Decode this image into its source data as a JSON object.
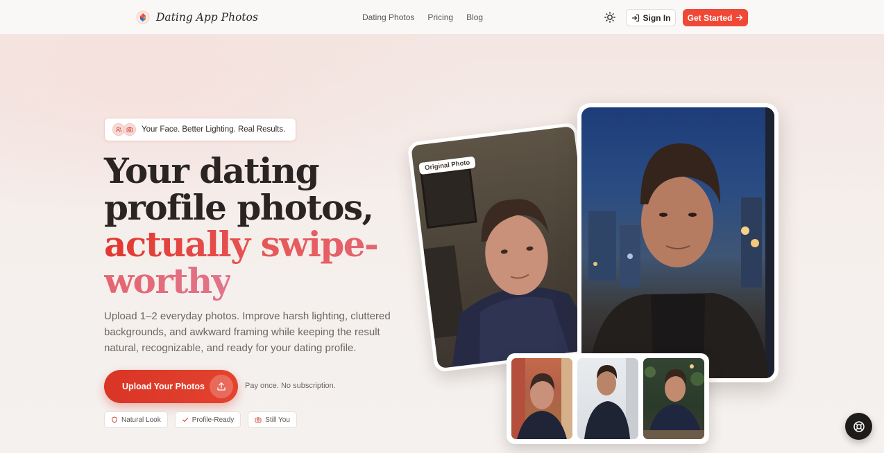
{
  "nav": {
    "brand": "Dating App Photos",
    "links": [
      "Dating Photos",
      "Pricing",
      "Blog"
    ],
    "sign_in": "Sign In",
    "get_started": "Get Started"
  },
  "hero": {
    "badge": "Your Face. Better Lighting. Real Results.",
    "headline_line1": "Your dating",
    "headline_line2": "profile photos,",
    "headline_accent": "actually swipe-worthy",
    "subtext": "Upload 1–2 everyday photos. Improve harsh lighting, cluttered backgrounds, and awkward framing while keeping the result natural, recognizable, and ready for your dating profile.",
    "upload_button": "Upload Your Photos",
    "pricing_note": "Pay once. No subscription.",
    "chips": [
      {
        "icon": "shield-icon",
        "label": "Natural Look"
      },
      {
        "icon": "check-icon",
        "label": "Profile-Ready"
      },
      {
        "icon": "camera-icon",
        "label": "Still You"
      }
    ]
  },
  "showcase": {
    "original_label": "Original Photo"
  },
  "colors": {
    "accent": "#ef4836",
    "accent_dark": "#d93526",
    "accent_pink": "#e2748a",
    "text": "#2a2522",
    "muted": "#6d6560"
  }
}
